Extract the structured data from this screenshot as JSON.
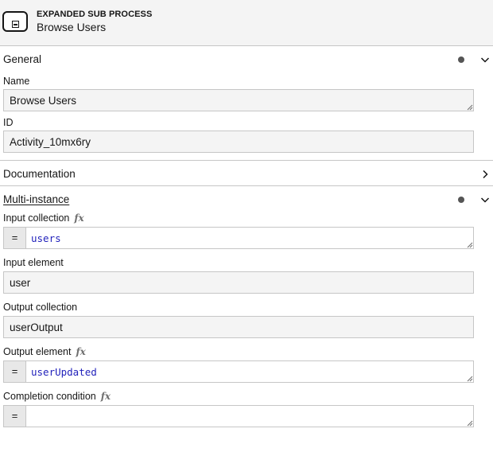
{
  "header": {
    "type_label": "EXPANDED SUB PROCESS",
    "element_name": "Browse Users",
    "icon": "expanded-subprocess-icon"
  },
  "general": {
    "title": "General",
    "name_label": "Name",
    "name_value": "Browse Users",
    "id_label": "ID",
    "id_value": "Activity_10mx6ry"
  },
  "documentation": {
    "title": "Documentation"
  },
  "multi_instance": {
    "title": "Multi-instance",
    "input_collection_label": "Input collection",
    "input_collection_value": "users",
    "input_element_label": "Input element",
    "input_element_value": "user",
    "output_collection_label": "Output collection",
    "output_collection_value": "userOutput",
    "output_element_label": "Output element",
    "output_element_value": "userUpdated",
    "completion_condition_label": "Completion condition",
    "completion_condition_value": "",
    "fx_symbol": "fx",
    "feel_prefix": "="
  }
}
